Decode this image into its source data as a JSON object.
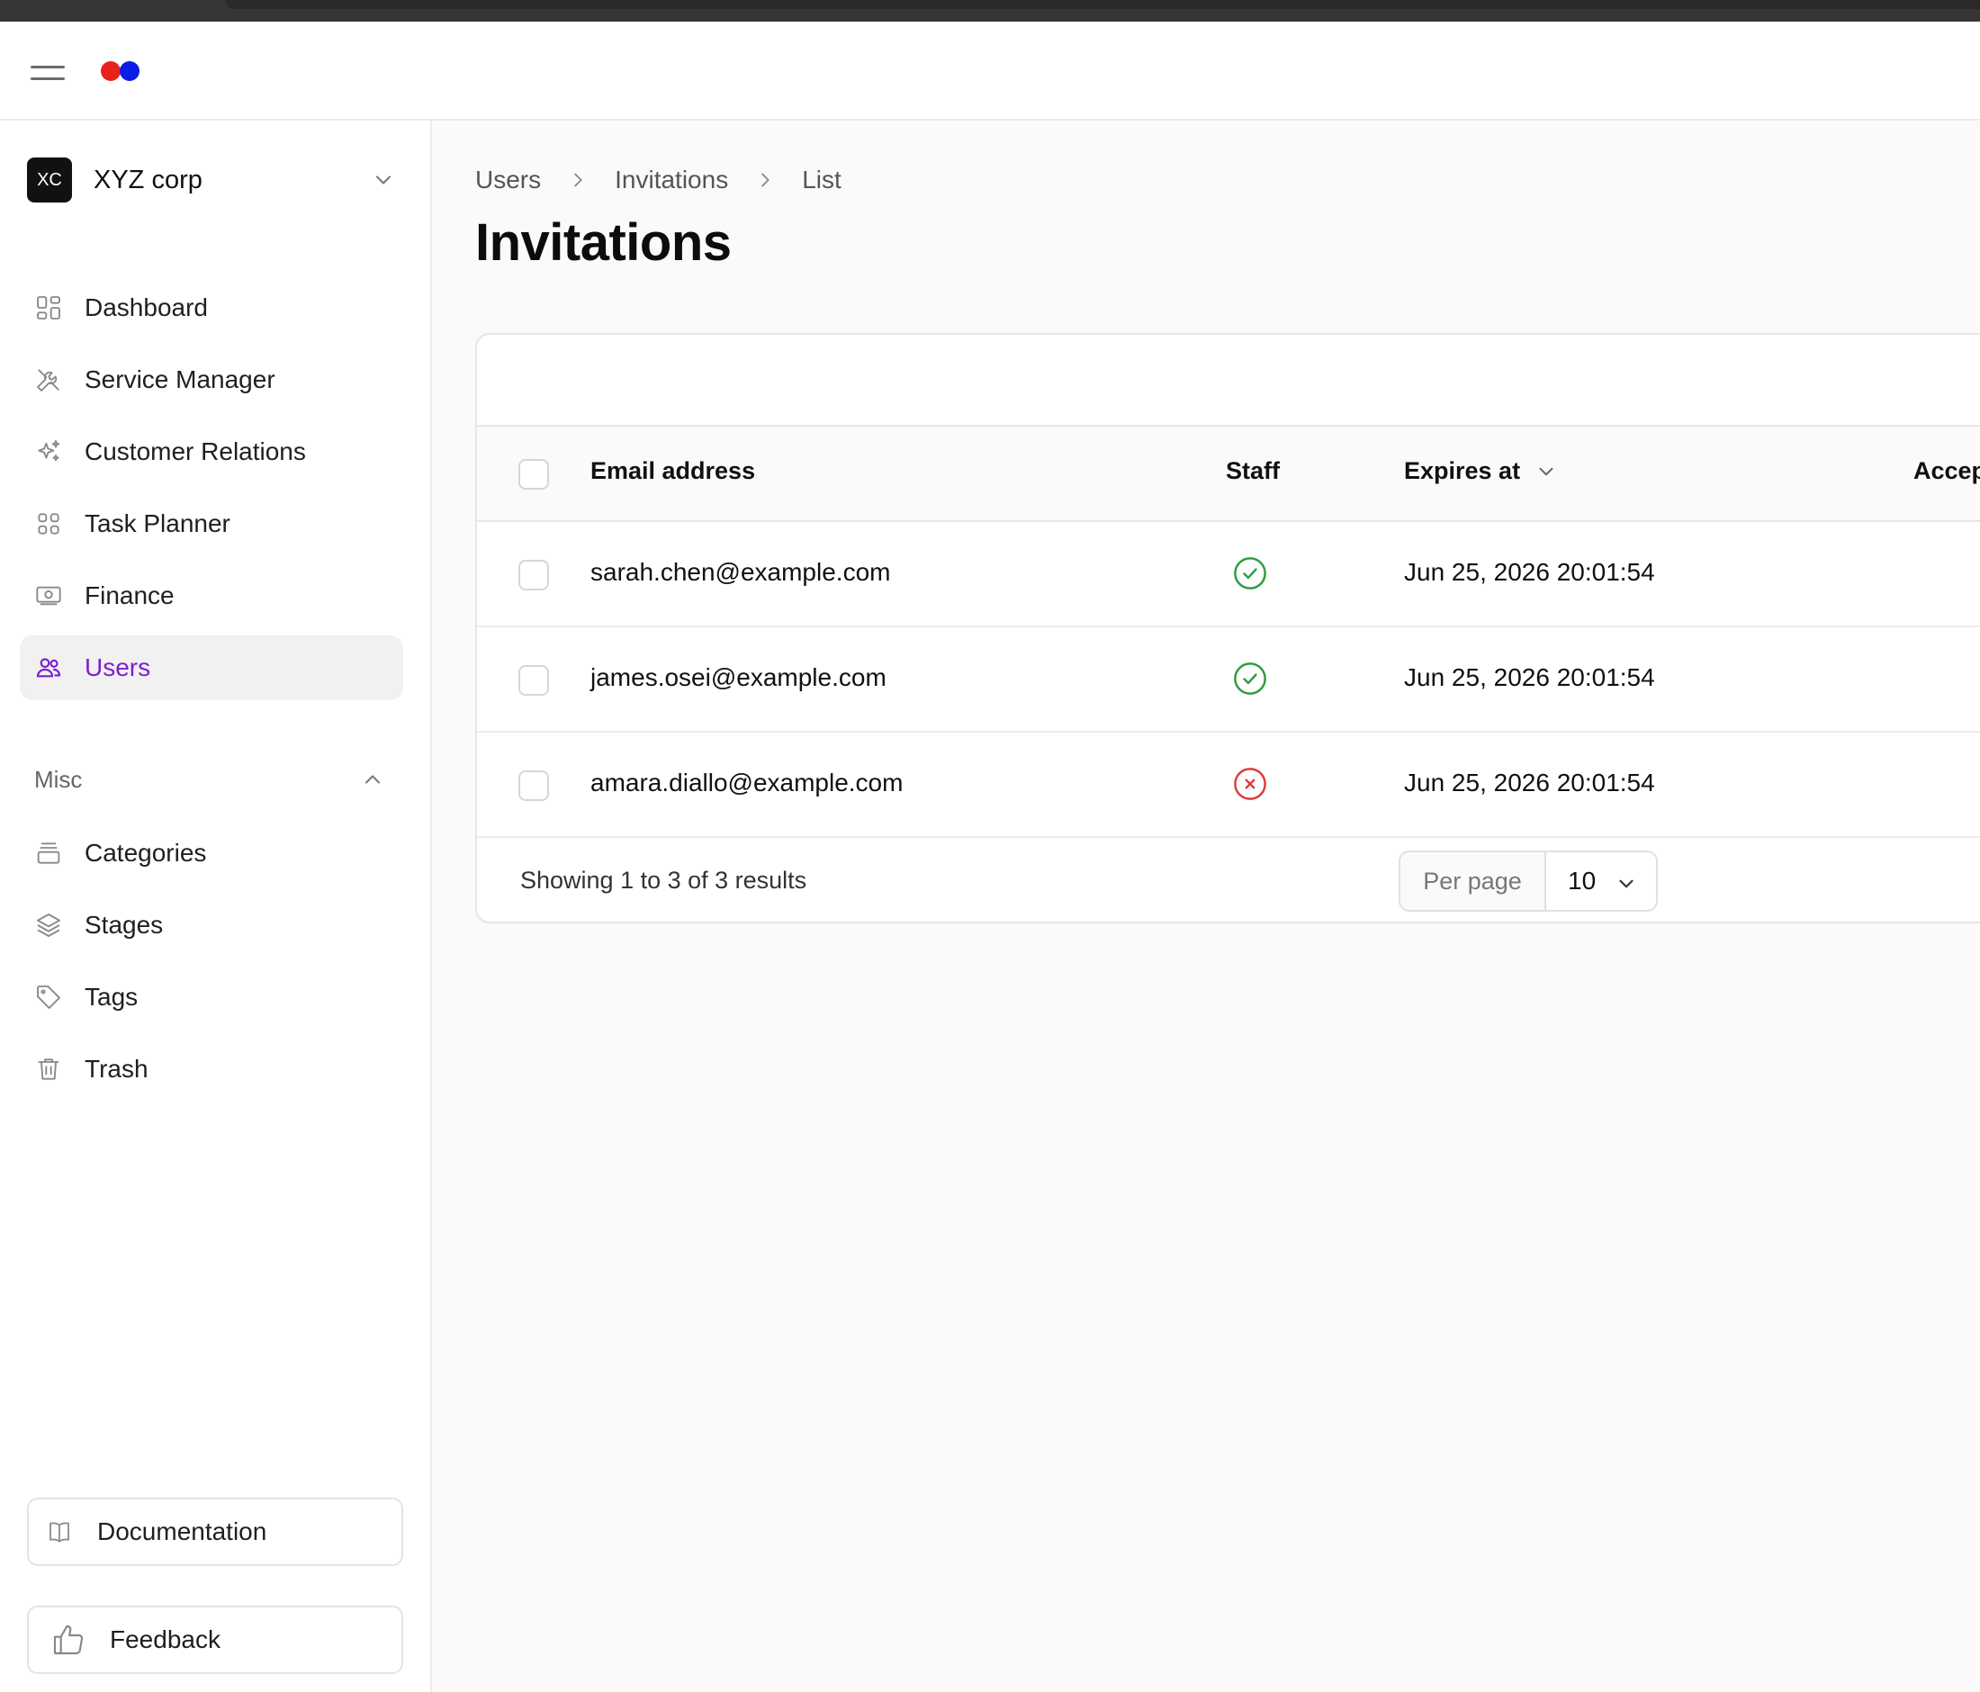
{
  "org": {
    "initials": "XC",
    "name": "XYZ corp"
  },
  "nav": {
    "items": [
      {
        "label": "Dashboard",
        "icon": "dashboard-icon"
      },
      {
        "label": "Service Manager",
        "icon": "tools-icon"
      },
      {
        "label": "Customer Relations",
        "icon": "sparkles-icon"
      },
      {
        "label": "Task Planner",
        "icon": "grid-icon"
      },
      {
        "label": "Finance",
        "icon": "banknote-icon"
      },
      {
        "label": "Users",
        "icon": "users-icon",
        "active": true
      }
    ],
    "misc_label": "Misc",
    "misc_items": [
      {
        "label": "Categories",
        "icon": "archive-icon"
      },
      {
        "label": "Stages",
        "icon": "layers-icon"
      },
      {
        "label": "Tags",
        "icon": "tag-icon"
      },
      {
        "label": "Trash",
        "icon": "trash-icon"
      }
    ],
    "documentation_label": "Documentation",
    "feedback_label": "Feedback"
  },
  "breadcrumb": [
    "Users",
    "Invitations",
    "List"
  ],
  "page": {
    "title": "Invitations"
  },
  "table": {
    "headers": {
      "email": "Email address",
      "staff": "Staff",
      "expires": "Expires at",
      "accepted": "Accep"
    },
    "rows": [
      {
        "email": "sarah.chen@example.com",
        "staff": true,
        "expires": "Jun 25, 2026 20:01:54"
      },
      {
        "email": "james.osei@example.com",
        "staff": true,
        "expires": "Jun 25, 2026 20:01:54"
      },
      {
        "email": "amara.diallo@example.com",
        "staff": false,
        "expires": "Jun 25, 2026 20:01:54"
      }
    ],
    "footer_text": "Showing 1 to 3 of 3 results",
    "per_page_label": "Per page",
    "per_page_value": "10"
  },
  "colors": {
    "accent": "#7b1fd1",
    "success": "#2e9c3f",
    "danger": "#e03a3a",
    "logo_red": "#e8211b",
    "logo_blue": "#0b1be8"
  }
}
